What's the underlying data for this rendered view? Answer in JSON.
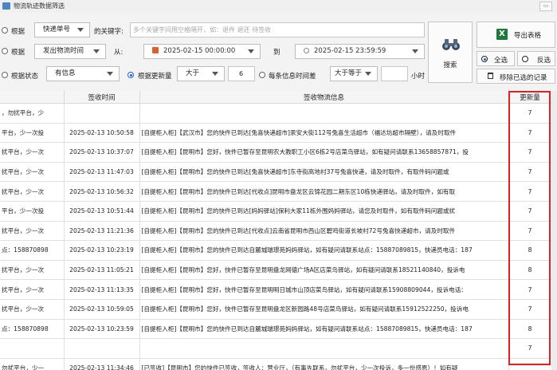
{
  "window": {
    "title": "物流轨迹数据筛选",
    "min": "▭"
  },
  "row1": {
    "radio_label": "根据",
    "field": "快递单号",
    "keyword_label": "的关键字:",
    "keyword_placeholder": "多个关键字间用空格隔开，如：退件 退还 待签收"
  },
  "row2": {
    "radio_label": "根据",
    "field": "发出物流时间",
    "from_label": "从:",
    "from_value": "2025-02-15 00:00:00",
    "to_label": "到",
    "to_value": "2025-02-15 23:59:59"
  },
  "row3": {
    "status_label": "根据状态",
    "status_value": "有信息",
    "update_label": "根据更新量",
    "cmp": "大于",
    "count": "6",
    "each_label": "每条信息时间差",
    "each_cmp": "大于等于",
    "hour_label": "小时"
  },
  "actions": {
    "search": "搜索",
    "export": "导出表格",
    "select_all": "全选",
    "invert": "反选",
    "remove": "移除已选的记录"
  },
  "table": {
    "headers": [
      "",
      "签收时间",
      "签收物流信息",
      "更新量"
    ],
    "rows": [
      {
        "c0": "，勿扰平台，少",
        "time": "",
        "info": "",
        "count": "7"
      },
      {
        "c0": "平台，少一次投",
        "time": "2025-02-13 10:50:58",
        "info": "[自提柜入柜]【武汉市】您的快件已到达[兔喜快递超市]汞安大街112号兔喜生活超市（福达坊超市隔壁），请及时取件",
        "count": "7"
      },
      {
        "c0": "扰平台，少一次",
        "time": "2025-02-13 10:37:07",
        "info": "[自提柜入柜]【昆明市】您好，快件已暂存至昆明农大教职工小区6栋2号店菜鸟驿站，如有疑问请联系13658857871，投",
        "count": "7"
      },
      {
        "c0": "扰平台，少一次",
        "time": "2025-02-13 11:47:03",
        "info": "[自提柜入柜]【昆明市】您的快件已到达[兔喜快递超市]东寺街高地村37号兔喜快递，请及时取件，有取件码问题或",
        "count": "7"
      },
      {
        "c0": "扰平台，少一次",
        "time": "2025-02-13 10:56:32",
        "info": "[自提柜入柜]【昆明市】您的快件已到达[代收点]昆明市盘龙区云锦花园二期东区10栋快递驿站，请及时取件，如有取",
        "count": "7"
      },
      {
        "c0": "平台，少一次投",
        "time": "2025-02-13 10:51:44",
        "info": "[自提柜入柜]【昆明市】您的快件已到达[妈妈驿站]保利大家11栋外围妈妈驿站，请您及时取件，如有取件码问题或扰",
        "count": "7"
      },
      {
        "c0": "扰平台，少一次",
        "time": "2025-02-13 11:21:36",
        "info": "[自提柜入柜]【昆明市】您的快件已到达[代收点]云南省昆明市西山区碧鸡街道长坡村72号兔喜快递超市，请及时取件",
        "count": "7"
      },
      {
        "c0": "点：158870898",
        "time": "2025-02-13 10:23:19",
        "info": "[自提柜入柜]【昆明市】您的快件已到达自麓城瑞璟苑妈妈驿站，如有疑问请联系站点：15887089815，快递员电话：187",
        "count": "8"
      },
      {
        "c0": "扰平台，少一次",
        "time": "2025-02-13 11:05:21",
        "info": "[自提柜入柜]【昆明市】您好，快件已暂存至昆明盘龙网德广场A区店菜鸟驿站，如有疑问请联系18521140840，投诉电",
        "count": "8"
      },
      {
        "c0": "扰平台，少一次",
        "time": "2025-02-13 11:13:35",
        "info": "[自提柜入柜]【昆明市】您好，快件已暂存至昆明明日城市山顶店菜鸟驿站，如有疑问请联系15908809044，投诉电话：",
        "count": "7"
      },
      {
        "c0": "扰平台，少一次",
        "time": "2025-02-13 10:59:05",
        "info": "[自提柜入柜]【昆明市】您好，快件已暂存至昆明盘龙区新园路48号店菜鸟驿站，如有疑问请联系15912522250，投诉电",
        "count": "7"
      },
      {
        "c0": "点：158870898",
        "time": "2025-02-13 10:23:59",
        "info": "[自提柜入柜]【昆明市】您的快件已到达自麓城瑞璟苑妈妈驿站，如有疑问请联系站点：15887089815，快递员电话：187",
        "count": "8"
      },
      {
        "c0": "",
        "time": "",
        "info": "",
        "count": "7"
      },
      {
        "c0": "勿扰平台，少一",
        "time": "2025-02-13 11:34:46",
        "info": "[已签收]【昆明市】您的快件已签收，签收人：营业厅，（有事先联系，勿扰平台，少一次投诉，多一份感恩）！如有疑",
        "count": ""
      }
    ]
  }
}
